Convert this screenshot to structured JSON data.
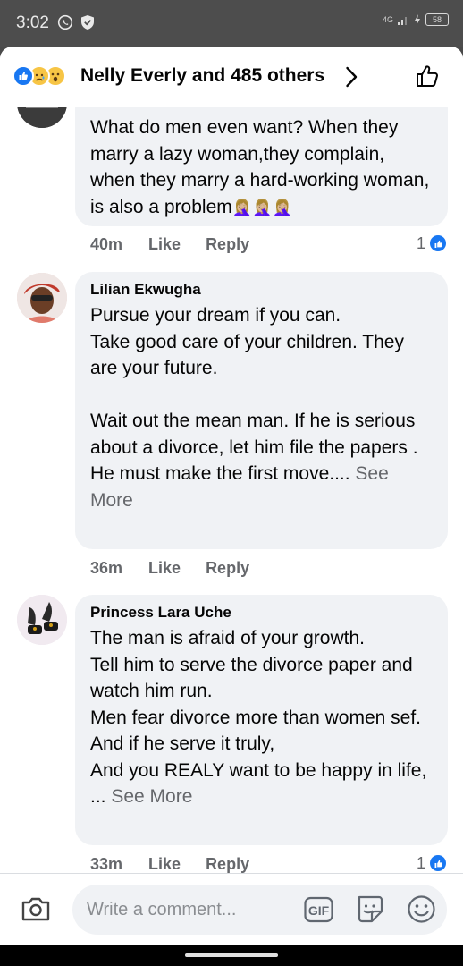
{
  "status": {
    "time": "3:02",
    "network": "4G",
    "battery": "58"
  },
  "header": {
    "title": "Nelly Everly and 485 others",
    "reactions": [
      "like",
      "sad",
      "wow"
    ]
  },
  "comments": [
    {
      "author": "",
      "text": "What do men even want? When they marry a lazy woman,they complain, when they marry a hard-working woman, is also a problem",
      "emoji": "🤦🏼‍♀️🤦🏼‍♀️🤦🏼‍♀️",
      "see_more": "",
      "time": "40m",
      "like": "Like",
      "reply": "Reply",
      "reaction_count": "1"
    },
    {
      "author": "Lilian Ekwugha",
      "text": "Pursue your dream if you can.\nTake good care of your children. They are your future.\n\nWait out the mean man. If he is serious about a divorce, let him file the papers .\nHe must make the first move....",
      "emoji": "",
      "see_more": " See More",
      "time": "36m",
      "like": "Like",
      "reply": "Reply",
      "reaction_count": ""
    },
    {
      "author": "Princess Lara Uche",
      "text": "The man is afraid of your growth.\nTell him to serve the divorce paper and watch him run.\nMen fear divorce more than women sef.\nAnd if he serve it truly,\nAnd you REALY want to be happy in life, ...",
      "emoji": "",
      "see_more": " See More",
      "time": "33m",
      "like": "Like",
      "reply": "Reply",
      "reaction_count": "1"
    }
  ],
  "composer": {
    "placeholder": "Write a comment...",
    "gif_label": "GIF"
  },
  "colors": {
    "accent": "#1877f2",
    "bubble": "#f0f2f5",
    "meta": "#65676b"
  }
}
